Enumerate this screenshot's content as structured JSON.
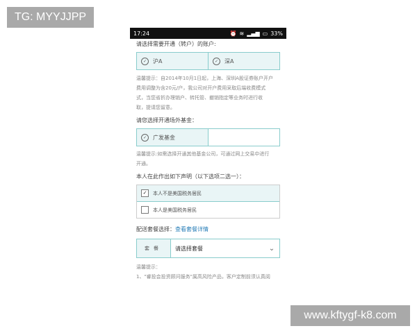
{
  "watermarks": {
    "top_left": "TG: MYYJJPP",
    "bottom_right": "www.kftygf-k8.com"
  },
  "statusbar": {
    "time": "17:24",
    "battery": "33%"
  },
  "account_section": {
    "question": "请选择需要开通（转户）的账户:",
    "options": [
      {
        "label": "沪A",
        "selected": true
      },
      {
        "label": "深A",
        "selected": true
      }
    ],
    "note_lines": [
      "温馨提示：自2014年10月1日起，上海、深圳A股证券账户开户",
      "费用调整为含20元/户，我公司对开户费用采取后端收费模式",
      "式，当您省折办理销户、转托管、撤销指定等业务时进行收",
      "取，提请您留意。"
    ]
  },
  "fund_section": {
    "question": "请您选择开通场外基金：",
    "option_label": "广发基金",
    "note_lines": [
      "温馨提示:如需选择开通其他基金公司，可通过网上交易中进行",
      "开通。"
    ]
  },
  "declaration": {
    "title": "本人在此作出如下声明（以下选项二选一）：",
    "options": [
      {
        "label": "本人不是美国税务居民",
        "checked": true,
        "check_symbol": "✓"
      },
      {
        "label": "本人是美国税务居民",
        "checked": false,
        "check_symbol": ""
      }
    ]
  },
  "package": {
    "title": "配送套餐选择：",
    "link": "查看套餐详情",
    "left_label": "套餐",
    "select_value": "请选择套餐"
  },
  "tips": {
    "label": "温馨提示：",
    "line1": "1、\"睿投会投资顾问服务\"属高风险产品，客户定制前须认真阅"
  }
}
